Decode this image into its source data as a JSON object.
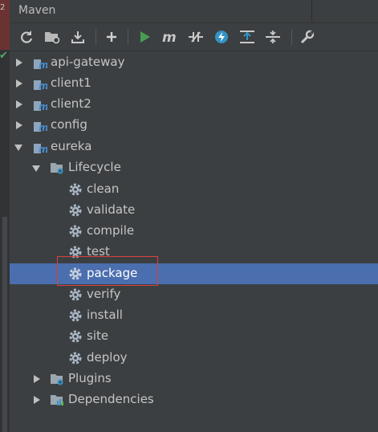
{
  "gutter": {
    "number": "2"
  },
  "panel": {
    "title": "Maven"
  },
  "toolbar": {
    "icons": [
      "reimport-icon",
      "generate-sources-icon",
      "download-icon",
      "add-icon",
      "run-icon",
      "execute-goal-icon",
      "toggle-offline-icon",
      "skip-tests-icon",
      "show-dependencies-icon",
      "collapse-all-icon",
      "settings-wrench-icon"
    ]
  },
  "tree": {
    "projects": [
      {
        "label": "api-gateway",
        "expanded": false
      },
      {
        "label": "client1",
        "expanded": false
      },
      {
        "label": "client2",
        "expanded": false
      },
      {
        "label": "config",
        "expanded": false
      },
      {
        "label": "eureka",
        "expanded": true
      }
    ],
    "lifecycle": {
      "label": "Lifecycle",
      "goals": [
        "clean",
        "validate",
        "compile",
        "test",
        "package",
        "verify",
        "install",
        "site",
        "deploy"
      ],
      "selected": "package"
    },
    "plugins": {
      "label": "Plugins"
    },
    "dependencies": {
      "label": "Dependencies"
    }
  },
  "colors": {
    "selection": "#4b6eaf",
    "highlight_box": "#d9413d",
    "run": "#499c54",
    "accent_blue": "#3592c4"
  }
}
